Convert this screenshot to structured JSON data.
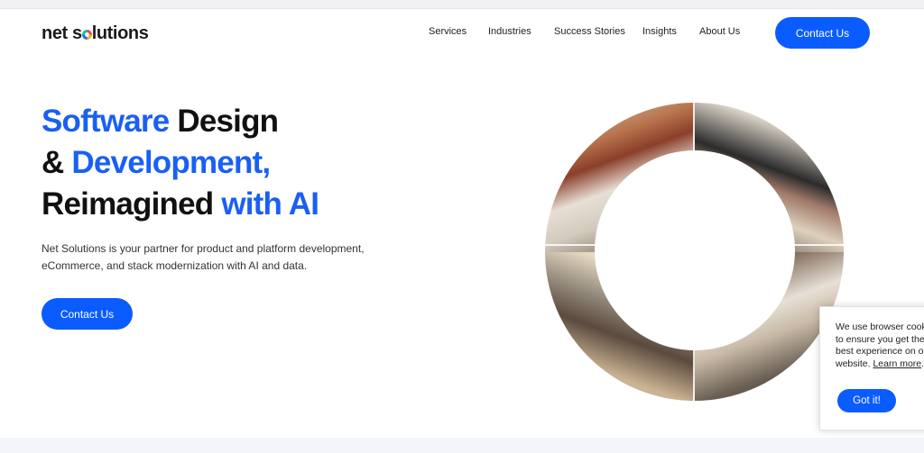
{
  "header": {
    "logo_text_before": "net s",
    "logo_text_after": "lutions",
    "nav": [
      {
        "label": "Services"
      },
      {
        "label": "Industries"
      },
      {
        "label": "Success Stories"
      },
      {
        "label": "Insights"
      },
      {
        "label": "About Us"
      }
    ],
    "cta_label": "Contact Us"
  },
  "hero": {
    "title": {
      "line1_blue": "Software",
      "line1_dark": " Design",
      "line2_dark": "& ",
      "line2_blue": "Development,",
      "line3_dark": "Reimagined ",
      "line3_blue": "with AI"
    },
    "subtitle_line1": "Net Solutions is your partner for product and platform development,",
    "subtitle_line2": "eCommerce, and stack modernization with AI and data.",
    "cta_label": "Contact Us"
  },
  "cookie": {
    "text_line1": "We use browser cook",
    "text_line2": "to ensure you get the",
    "text_line3": "best experience on ou",
    "text_line4_before": "website. ",
    "link_label": "Learn more",
    "text_line4_after": ".",
    "button_label": "Got it!"
  },
  "colors": {
    "accent": "#0a5cff",
    "heading_blue": "#1a5ff5",
    "text_dark": "#111111"
  }
}
